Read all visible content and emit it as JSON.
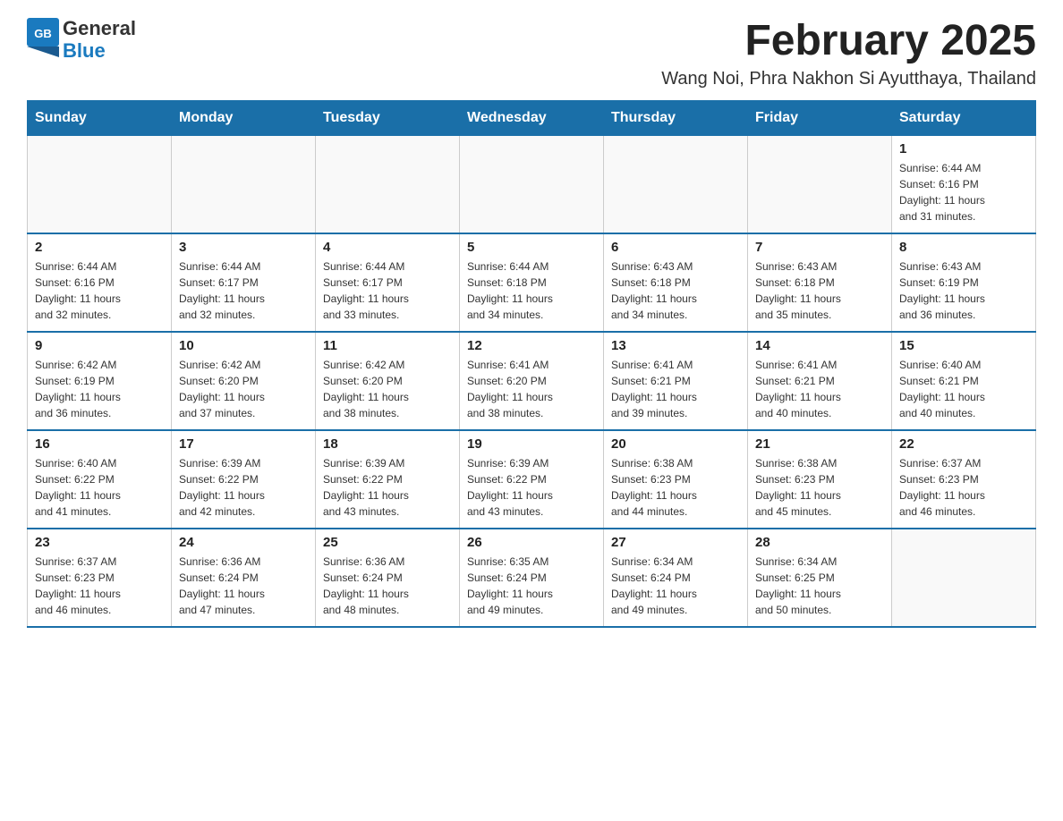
{
  "header": {
    "logo_general": "General",
    "logo_blue": "Blue",
    "title": "February 2025",
    "subtitle": "Wang Noi, Phra Nakhon Si Ayutthaya, Thailand"
  },
  "weekdays": [
    "Sunday",
    "Monday",
    "Tuesday",
    "Wednesday",
    "Thursday",
    "Friday",
    "Saturday"
  ],
  "weeks": [
    [
      {
        "day": "",
        "info": ""
      },
      {
        "day": "",
        "info": ""
      },
      {
        "day": "",
        "info": ""
      },
      {
        "day": "",
        "info": ""
      },
      {
        "day": "",
        "info": ""
      },
      {
        "day": "",
        "info": ""
      },
      {
        "day": "1",
        "info": "Sunrise: 6:44 AM\nSunset: 6:16 PM\nDaylight: 11 hours\nand 31 minutes."
      }
    ],
    [
      {
        "day": "2",
        "info": "Sunrise: 6:44 AM\nSunset: 6:16 PM\nDaylight: 11 hours\nand 32 minutes."
      },
      {
        "day": "3",
        "info": "Sunrise: 6:44 AM\nSunset: 6:17 PM\nDaylight: 11 hours\nand 32 minutes."
      },
      {
        "day": "4",
        "info": "Sunrise: 6:44 AM\nSunset: 6:17 PM\nDaylight: 11 hours\nand 33 minutes."
      },
      {
        "day": "5",
        "info": "Sunrise: 6:44 AM\nSunset: 6:18 PM\nDaylight: 11 hours\nand 34 minutes."
      },
      {
        "day": "6",
        "info": "Sunrise: 6:43 AM\nSunset: 6:18 PM\nDaylight: 11 hours\nand 34 minutes."
      },
      {
        "day": "7",
        "info": "Sunrise: 6:43 AM\nSunset: 6:18 PM\nDaylight: 11 hours\nand 35 minutes."
      },
      {
        "day": "8",
        "info": "Sunrise: 6:43 AM\nSunset: 6:19 PM\nDaylight: 11 hours\nand 36 minutes."
      }
    ],
    [
      {
        "day": "9",
        "info": "Sunrise: 6:42 AM\nSunset: 6:19 PM\nDaylight: 11 hours\nand 36 minutes."
      },
      {
        "day": "10",
        "info": "Sunrise: 6:42 AM\nSunset: 6:20 PM\nDaylight: 11 hours\nand 37 minutes."
      },
      {
        "day": "11",
        "info": "Sunrise: 6:42 AM\nSunset: 6:20 PM\nDaylight: 11 hours\nand 38 minutes."
      },
      {
        "day": "12",
        "info": "Sunrise: 6:41 AM\nSunset: 6:20 PM\nDaylight: 11 hours\nand 38 minutes."
      },
      {
        "day": "13",
        "info": "Sunrise: 6:41 AM\nSunset: 6:21 PM\nDaylight: 11 hours\nand 39 minutes."
      },
      {
        "day": "14",
        "info": "Sunrise: 6:41 AM\nSunset: 6:21 PM\nDaylight: 11 hours\nand 40 minutes."
      },
      {
        "day": "15",
        "info": "Sunrise: 6:40 AM\nSunset: 6:21 PM\nDaylight: 11 hours\nand 40 minutes."
      }
    ],
    [
      {
        "day": "16",
        "info": "Sunrise: 6:40 AM\nSunset: 6:22 PM\nDaylight: 11 hours\nand 41 minutes."
      },
      {
        "day": "17",
        "info": "Sunrise: 6:39 AM\nSunset: 6:22 PM\nDaylight: 11 hours\nand 42 minutes."
      },
      {
        "day": "18",
        "info": "Sunrise: 6:39 AM\nSunset: 6:22 PM\nDaylight: 11 hours\nand 43 minutes."
      },
      {
        "day": "19",
        "info": "Sunrise: 6:39 AM\nSunset: 6:22 PM\nDaylight: 11 hours\nand 43 minutes."
      },
      {
        "day": "20",
        "info": "Sunrise: 6:38 AM\nSunset: 6:23 PM\nDaylight: 11 hours\nand 44 minutes."
      },
      {
        "day": "21",
        "info": "Sunrise: 6:38 AM\nSunset: 6:23 PM\nDaylight: 11 hours\nand 45 minutes."
      },
      {
        "day": "22",
        "info": "Sunrise: 6:37 AM\nSunset: 6:23 PM\nDaylight: 11 hours\nand 46 minutes."
      }
    ],
    [
      {
        "day": "23",
        "info": "Sunrise: 6:37 AM\nSunset: 6:23 PM\nDaylight: 11 hours\nand 46 minutes."
      },
      {
        "day": "24",
        "info": "Sunrise: 6:36 AM\nSunset: 6:24 PM\nDaylight: 11 hours\nand 47 minutes."
      },
      {
        "day": "25",
        "info": "Sunrise: 6:36 AM\nSunset: 6:24 PM\nDaylight: 11 hours\nand 48 minutes."
      },
      {
        "day": "26",
        "info": "Sunrise: 6:35 AM\nSunset: 6:24 PM\nDaylight: 11 hours\nand 49 minutes."
      },
      {
        "day": "27",
        "info": "Sunrise: 6:34 AM\nSunset: 6:24 PM\nDaylight: 11 hours\nand 49 minutes."
      },
      {
        "day": "28",
        "info": "Sunrise: 6:34 AM\nSunset: 6:25 PM\nDaylight: 11 hours\nand 50 minutes."
      },
      {
        "day": "",
        "info": ""
      }
    ]
  ]
}
